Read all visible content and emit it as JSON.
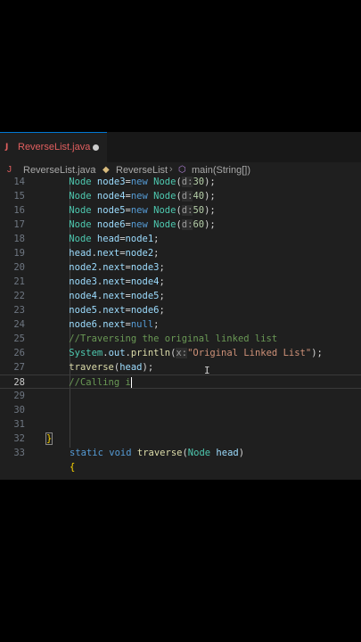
{
  "tab": {
    "icon": "J",
    "label": "ReverseList.java"
  },
  "breadcrumb": {
    "file": "ReverseList.java",
    "cls": "ReverseList",
    "method": "main(String[])"
  },
  "lines": {
    "l14": "14",
    "l15": "15",
    "l16": "16",
    "l17": "17",
    "l18": "18",
    "l19": "19",
    "l20": "20",
    "l21": "21",
    "l22": "22",
    "l23": "23",
    "l24": "24",
    "l25": "25",
    "l26": "26",
    "l27": "27",
    "l28": "28",
    "l29": "29",
    "l30": "30",
    "l31": "31",
    "l32": "32",
    "l33": "33"
  },
  "code": {
    "node": "Node",
    "new": "new",
    "null": "null",
    "static": "static",
    "void": "void",
    "d": "d:",
    "x": "x:",
    "node3": "node3",
    "node4": "node4",
    "node5": "node5",
    "node6": "node6",
    "head": "head",
    "node1": "node1",
    "node2": "node2",
    "next": "next",
    "n30": "30",
    "n40": "40",
    "n50": "50",
    "n60": "60",
    "system": "System",
    "out": "out",
    "println": "println",
    "traverse": "traverse",
    "str_orig": "\"Original Linked List\"",
    "c25": "//Traversing the original linked list",
    "c28": "//Calling i",
    "brace_close": "}",
    "brace_open": "{"
  }
}
